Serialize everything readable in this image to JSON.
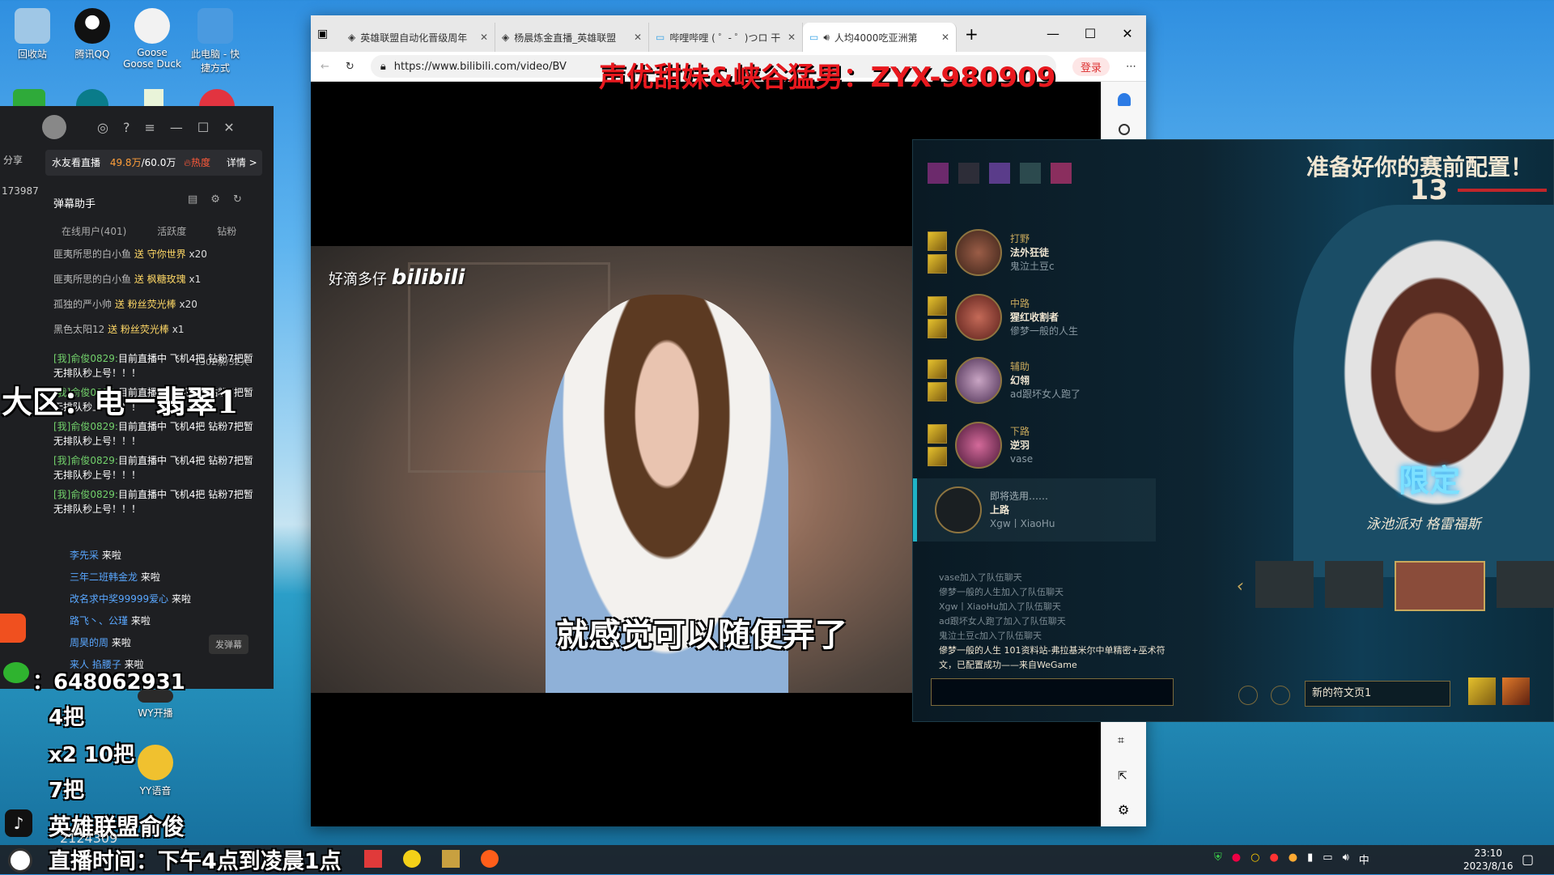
{
  "desktop": {
    "icons": [
      {
        "label": "回收站",
        "color": "#9fc7e6"
      },
      {
        "label": "腾讯QQ",
        "color": "#1a1a1a"
      },
      {
        "label": "Goose\nGoose Duck",
        "color": "#f2f2f2"
      },
      {
        "label": "此电脑 - 快\n捷方式",
        "color": "#4a9ae0"
      }
    ],
    "bottom_icons": [
      {
        "label": "WY开播",
        "color": "#2a2a2a"
      },
      {
        "label": "YY语音",
        "color": "#f0c12f"
      }
    ]
  },
  "browser": {
    "tabs": [
      {
        "label": "英雄联盟自动化晋级周年"
      },
      {
        "label": "杨晨炼金直播_英雄联盟"
      },
      {
        "label": "哔哩哔哩 ( ゜- ゜)つロ 干"
      },
      {
        "label": "人均4000吃亚洲第"
      }
    ],
    "url": "https://www.bilibili.com/video/BV",
    "watermark": "好滴多仔",
    "watermark_logo": "bilibili",
    "subtitle": "就感觉可以随便弄了",
    "profile": "登录"
  },
  "overlay": {
    "red_caption": "声优甜妹&峡谷猛男：ZYX-980909",
    "region": "大区：电一翡翠1",
    "qq_number": "：648062931",
    "count1": "4把",
    "count2": "x2 10把",
    "count3": "7把",
    "douyin": "英雄联盟俞俊",
    "douyin_id": "2124309",
    "schedule": "直播时间：下午4点到凌晨1点"
  },
  "lol": {
    "header": "准备好你的赛前配置！",
    "timer": "13",
    "team": [
      {
        "role": "打野",
        "champ": "法外狂徒",
        "player": "鬼泣土豆c"
      },
      {
        "role": "中路",
        "champ": "猩红收割者",
        "player": "傪梦一般的人生"
      },
      {
        "role": "辅助",
        "champ": "幻翎",
        "player": "ad跟坏女人跑了"
      },
      {
        "role": "下路",
        "champ": "逆羽",
        "player": "vase"
      },
      {
        "role": "即将选用……",
        "champ": "上路",
        "player": "Xgw丨XiaoHu"
      }
    ],
    "limited": "限定",
    "skin_name": "泳池派对 格雷福斯",
    "chat": [
      "vase加入了队伍聊天",
      "傪梦一般的人生加入了队伍聊天",
      "Xgw丨XiaoHu加入了队伍聊天",
      "ad跟坏女人跑了加入了队伍聊天",
      "鬼泣土豆c加入了队伍聊天"
    ],
    "chat_highlight": "傪梦一般的人生 101资料站-弗拉基米尔中单精密+巫术符文，已配置成功——来自WeGame",
    "rune_page": "新的符文页1"
  },
  "live": {
    "tabs": [
      "分享"
    ],
    "viewer_label": "水友看直播",
    "viewer_count": "49.8万",
    "viewer_max": "/60.0万",
    "hot": "热度",
    "detail": "详情 >",
    "side_number": "173987",
    "assistant": "弹幕助手",
    "subtabs": [
      "在线用户(401)",
      "活跃度",
      "钻粉"
    ],
    "gifts": [
      {
        "user": "匪夷所思的白小鱼",
        "gift": "送 守你世界",
        "count": "x20"
      },
      {
        "user": "匪夷所思的白小鱼",
        "gift": "送 枫糖玫瑰",
        "count": "x1"
      },
      {
        "user": "孤独的严小帅",
        "gift": "送 粉丝荧光棒",
        "count": "x20"
      },
      {
        "user": "黑色太阳12",
        "gift": "送 粉丝荧光棒",
        "count": "x1"
      }
    ],
    "pending": "1302条/32人",
    "messages": [
      {
        "user": "[我]俞俊0829:",
        "text": "目前直播中 飞机4把 钻粉7把暂无排队秒上号！！！"
      },
      {
        "user": "[我]俞俊0829:",
        "text": "目前直播中 飞机4把 钻粉7把暂无排队秒上号！！！"
      },
      {
        "user": "[我]俞俊0829:",
        "text": "目前直播中 飞机4把 钻粉7把暂无排队秒上号！！！"
      },
      {
        "user": "[我]俞俊0829:",
        "text": "目前直播中 飞机4把 钻粉7把暂无排队秒上号！！！"
      },
      {
        "user": "[我]俞俊0829:",
        "text": "目前直播中 飞机4把 钻粉7把暂无排队秒上号！！！"
      }
    ],
    "entries": [
      {
        "user": "李先采",
        "text": "来啦"
      },
      {
        "user": "三年二班韩金龙",
        "text": "来啦"
      },
      {
        "user": "改名求中奖99999爱心",
        "text": "来啦"
      },
      {
        "user": "路飞丶、公瑾",
        "text": "来啦"
      },
      {
        "user": "周昊的周",
        "text": "来啦"
      },
      {
        "user": "来人 掐腰子",
        "text": "来啦"
      }
    ],
    "send_button": "发弹幕"
  },
  "taskbar": {
    "time": "23:10",
    "date": "2023/8/16",
    "ime": "中"
  }
}
